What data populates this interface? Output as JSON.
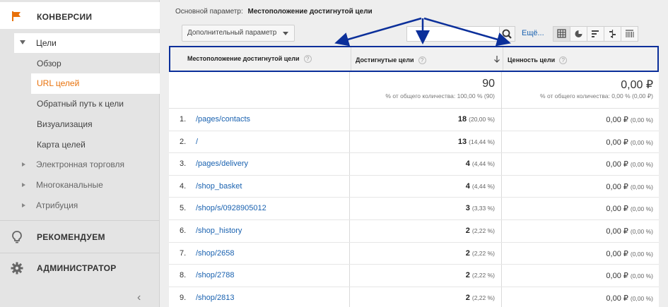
{
  "sidebar": {
    "conversions": "КОНВЕРСИИ",
    "goals": "Цели",
    "items": [
      "Обзор",
      "URL целей",
      "Обратный путь к цели",
      "Визуализация",
      "Карта целей"
    ],
    "categories": [
      "Электронная торговля",
      "Многоканальные",
      "Атрибуция"
    ],
    "recommend": "РЕКОМЕНДУЕМ",
    "admin": "АДМИНИСТРАТОР",
    "collapse_glyph": "‹",
    "active_color": "#e8710a"
  },
  "toolbar": {
    "primary_label": "Основной параметр:",
    "primary_value": "Местоположение достигнутой цели",
    "secondary_button": "Дополнительный параметр",
    "more_link": "Ещё..."
  },
  "table": {
    "headers": {
      "location": "Местоположение достигнутой цели",
      "completions": "Достигнутые цели",
      "value": "Ценность цели",
      "help_glyph": "?"
    },
    "totals": {
      "completions": "90",
      "completions_sub": "% от общего количества: 100,00 % (90)",
      "value": "0,00 ₽",
      "value_sub": "% от общего количества: 0,00 % (0,00 ₽)"
    },
    "rows": [
      {
        "idx": "1.",
        "path": "/pages/contacts",
        "count": "18",
        "pct": "(20,00 %)",
        "value": "0,00 ₽",
        "vpct": "(0,00 %)"
      },
      {
        "idx": "2.",
        "path": "/",
        "count": "13",
        "pct": "(14,44 %)",
        "value": "0,00 ₽",
        "vpct": "(0,00 %)"
      },
      {
        "idx": "3.",
        "path": "/pages/delivery",
        "count": "4",
        "pct": "(4,44 %)",
        "value": "0,00 ₽",
        "vpct": "(0,00 %)"
      },
      {
        "idx": "4.",
        "path": "/shop_basket",
        "count": "4",
        "pct": "(4,44 %)",
        "value": "0,00 ₽",
        "vpct": "(0,00 %)"
      },
      {
        "idx": "5.",
        "path": "/shop/s/0928905012",
        "count": "3",
        "pct": "(3,33 %)",
        "value": "0,00 ₽",
        "vpct": "(0,00 %)"
      },
      {
        "idx": "6.",
        "path": "/shop_history",
        "count": "2",
        "pct": "(2,22 %)",
        "value": "0,00 ₽",
        "vpct": "(0,00 %)"
      },
      {
        "idx": "7.",
        "path": "/shop/2658",
        "count": "2",
        "pct": "(2,22 %)",
        "value": "0,00 ₽",
        "vpct": "(0,00 %)"
      },
      {
        "idx": "8.",
        "path": "/shop/2788",
        "count": "2",
        "pct": "(2,22 %)",
        "value": "0,00 ₽",
        "vpct": "(0,00 %)"
      },
      {
        "idx": "9.",
        "path": "/shop/2813",
        "count": "2",
        "pct": "(2,22 %)",
        "value": "0,00 ₽",
        "vpct": "(0,00 %)"
      }
    ]
  },
  "annotation": {
    "arrow_color": "#0b2f9a"
  }
}
